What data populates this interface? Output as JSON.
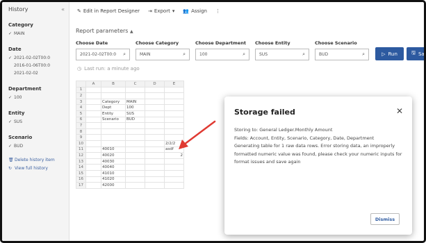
{
  "sidebar": {
    "title": "History",
    "collapse_icon": "«",
    "sections": [
      {
        "heading": "Category",
        "items": [
          {
            "checked": true,
            "label": "MAIN"
          }
        ]
      },
      {
        "heading": "Date",
        "items": [
          {
            "checked": true,
            "label": "2021-02-02T00:0"
          },
          {
            "checked": false,
            "label": "2016-01-06T00:0"
          },
          {
            "checked": false,
            "label": "2021-02-02"
          }
        ]
      },
      {
        "heading": "Department",
        "items": [
          {
            "checked": true,
            "label": "100"
          }
        ]
      },
      {
        "heading": "Entity",
        "items": [
          {
            "checked": true,
            "label": "SUS"
          }
        ]
      },
      {
        "heading": "Scenario",
        "items": [
          {
            "checked": true,
            "label": "BUD"
          }
        ]
      }
    ],
    "links": [
      {
        "icon": "trash-icon",
        "label": "Delete history item"
      },
      {
        "icon": "history-icon",
        "label": "View full history"
      }
    ]
  },
  "toolbar": {
    "edit_label": "Edit in Report Designer",
    "export_label": "Export",
    "assign_label": "Assign",
    "more_icon": "⋮"
  },
  "report_params": {
    "label": "Report parameters",
    "fields": [
      {
        "label": "Choose Date",
        "value": "2021-02-02T00:0"
      },
      {
        "label": "Choose Category",
        "value": "MAIN"
      },
      {
        "label": "Choose Department",
        "value": "100"
      },
      {
        "label": "Choose Entity",
        "value": "SUS"
      },
      {
        "label": "Choose Scenario",
        "value": "BUD"
      }
    ],
    "run_label": "Run",
    "save_label": "Sa"
  },
  "last_run": "Last run: a minute ago",
  "sheet": {
    "columns": [
      "",
      "A",
      "B",
      "C",
      "D",
      "E"
    ],
    "rows": [
      [
        "1",
        "",
        "",
        "",
        "",
        ""
      ],
      [
        "2",
        "",
        "",
        "",
        "",
        ""
      ],
      [
        "3",
        "",
        "Category",
        "MAIN",
        "",
        ""
      ],
      [
        "4",
        "",
        "Dept",
        "100",
        "",
        ""
      ],
      [
        "5",
        "",
        "Entity",
        "SUS",
        "",
        ""
      ],
      [
        "6",
        "",
        "Scenario",
        "BUD",
        "",
        ""
      ],
      [
        "7",
        "",
        "",
        "",
        "",
        ""
      ],
      [
        "8",
        "",
        "",
        "",
        "",
        ""
      ],
      [
        "9",
        "",
        "",
        "",
        "",
        ""
      ],
      [
        "10",
        "",
        "",
        "",
        "",
        "2/2/2"
      ],
      [
        "11",
        "",
        "40010",
        "",
        "",
        "asdf"
      ],
      [
        "12",
        "",
        "40020",
        "",
        "",
        "2"
      ],
      [
        "13",
        "",
        "40030",
        "",
        "",
        ""
      ],
      [
        "14",
        "",
        "40040",
        "",
        "",
        ""
      ],
      [
        "15",
        "",
        "41010",
        "",
        "",
        ""
      ],
      [
        "16",
        "",
        "41020",
        "",
        "",
        ""
      ],
      [
        "17",
        "",
        "42000",
        "",
        "",
        ""
      ]
    ]
  },
  "dialog": {
    "title": "Storage failed",
    "close_icon": "✕",
    "lines": [
      "Storing to: General Ledger.Monthly Amount",
      "Fields: Account, Entity, Scenario, Category, Date, Department",
      "Generating table for 1 raw data rows. Error storing data, an improperly formatted numeric value was found, please check your numeric inputs for format issues and save again"
    ],
    "dismiss_label": "Dismiss"
  },
  "colors": {
    "accent": "#2d5aa0",
    "arrow": "#e03a32"
  }
}
